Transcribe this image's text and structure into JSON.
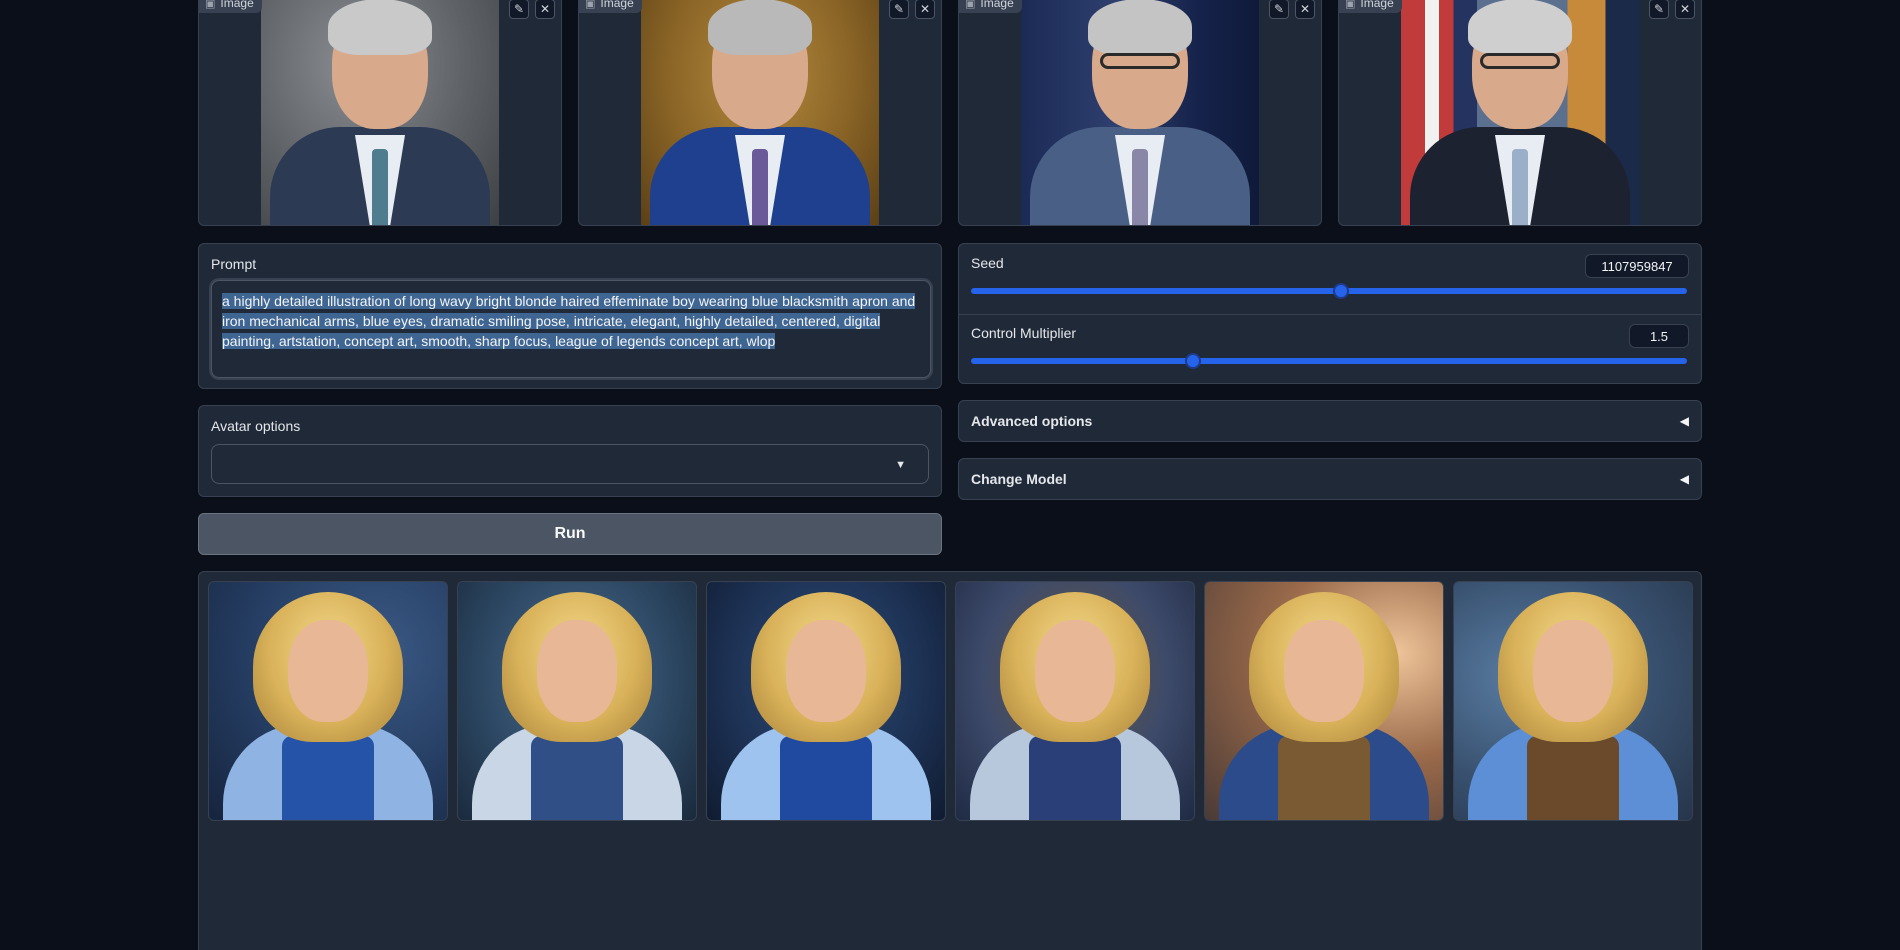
{
  "input_images": [
    {
      "label": "Image",
      "edit_icon": "pencil-icon",
      "clear_icon": "close-icon"
    },
    {
      "label": "Image",
      "edit_icon": "pencil-icon",
      "clear_icon": "close-icon"
    },
    {
      "label": "Image",
      "edit_icon": "pencil-icon",
      "clear_icon": "close-icon"
    },
    {
      "label": "Image",
      "edit_icon": "pencil-icon",
      "clear_icon": "close-icon"
    }
  ],
  "prompt": {
    "label": "Prompt",
    "value": "a highly detailed illustration of long wavy bright blonde haired effeminate boy wearing blue blacksmith apron and iron mechanical arms, blue eyes, dramatic smiling pose, intricate, elegant, highly detailed, centered, digital painting, artstation, concept art, smooth, sharp focus, league of legends concept art, wlop"
  },
  "seed": {
    "label": "Seed",
    "value": "1107959847",
    "fraction": 0.52
  },
  "control_multiplier": {
    "label": "Control Multiplier",
    "value": "1.5",
    "fraction": 0.31
  },
  "advanced_options": {
    "label": "Advanced options",
    "icon": "triangle-left-icon"
  },
  "change_model": {
    "label": "Change Model",
    "icon": "triangle-left-icon"
  },
  "avatar_options": {
    "label": "Avatar options",
    "value": "",
    "icon": "caret-down-icon"
  },
  "run_button": {
    "label": "Run"
  },
  "colors": {
    "accent": "#2563eb",
    "panel": "#1f2937",
    "background": "#0b0f19"
  }
}
